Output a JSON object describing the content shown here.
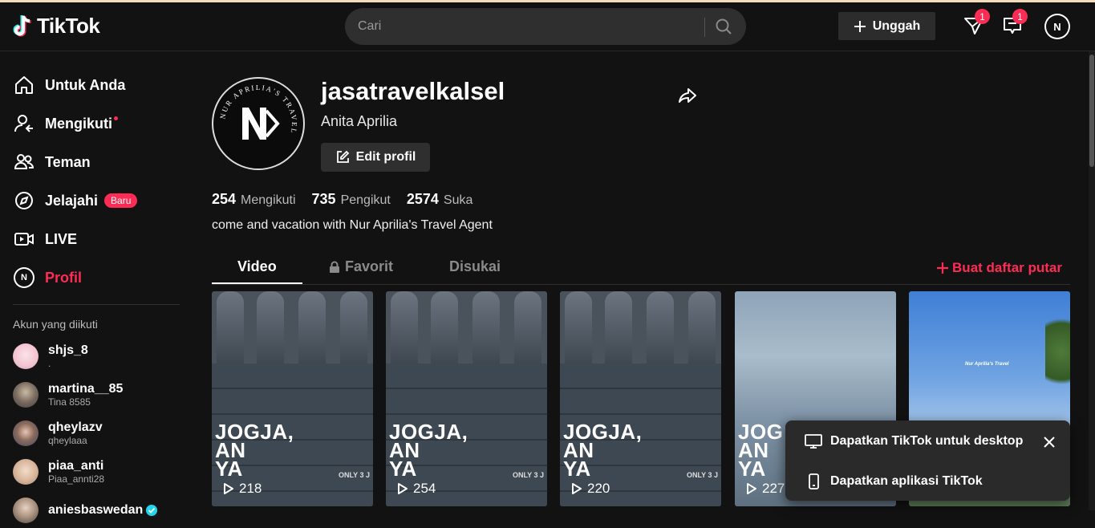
{
  "header": {
    "logo_text": "TikTok",
    "search_placeholder": "Cari",
    "upload_label": "Unggah",
    "inbox_badge": "1",
    "messages_badge": "1"
  },
  "sidebar": {
    "nav": [
      {
        "label": "Untuk Anda",
        "icon": "home-icon"
      },
      {
        "label": "Mengikuti",
        "icon": "following-icon"
      },
      {
        "label": "Teman",
        "icon": "friends-icon"
      },
      {
        "label": "Jelajahi",
        "icon": "compass-icon",
        "badge": "Baru"
      },
      {
        "label": "LIVE",
        "icon": "live-icon"
      },
      {
        "label": "Profil",
        "icon": "profile-avatar"
      }
    ],
    "following_title": "Akun yang diikuti",
    "accounts": [
      {
        "name": "shjs_8",
        "sub": "."
      },
      {
        "name": "martina__85",
        "sub": "Tina 8585"
      },
      {
        "name": "qheylazv",
        "sub": "qheylaaa"
      },
      {
        "name": "piaa_anti",
        "sub": "Piaa_annti28"
      },
      {
        "name": "aniesbaswedan",
        "sub": ""
      }
    ]
  },
  "profile": {
    "username": "jasatravelkalsel",
    "nickname": "Anita Aprilia",
    "edit_label": "Edit profil",
    "avatar_ring_text": "NUR APRILIA'S TRAVEL",
    "stats": {
      "following_count": "254",
      "following_label": "Mengikuti",
      "followers_count": "735",
      "followers_label": "Pengikut",
      "likes_count": "2574",
      "likes_label": "Suka"
    },
    "bio": "come and vacation with Nur Aprilia's Travel Agent"
  },
  "tabs": {
    "video": "Video",
    "favorites": "Favorit",
    "liked": "Disukai",
    "playlist": "Buat daftar putar"
  },
  "videos": [
    {
      "views": "218",
      "line1": "JOGJA,",
      "line2": "AN",
      "line3": "YA",
      "tag": "ONLY 3 J"
    },
    {
      "views": "254",
      "line1": "JOGJA,",
      "line2": "AN",
      "line3": "YA",
      "tag": "ONLY 3 J"
    },
    {
      "views": "220",
      "line1": "JOGJA,",
      "line2": "AN",
      "line3": "YA",
      "tag": "ONLY 3 J"
    },
    {
      "views": "227",
      "line1": "JOG",
      "line2": "AN",
      "line3": "YA",
      "tag": ""
    },
    {
      "views": "",
      "caption": "Nur Aprilia's Travel"
    }
  ],
  "popup": {
    "desktop": "Dapatkan TikTok untuk desktop",
    "app": "Dapatkan aplikasi TikTok"
  }
}
